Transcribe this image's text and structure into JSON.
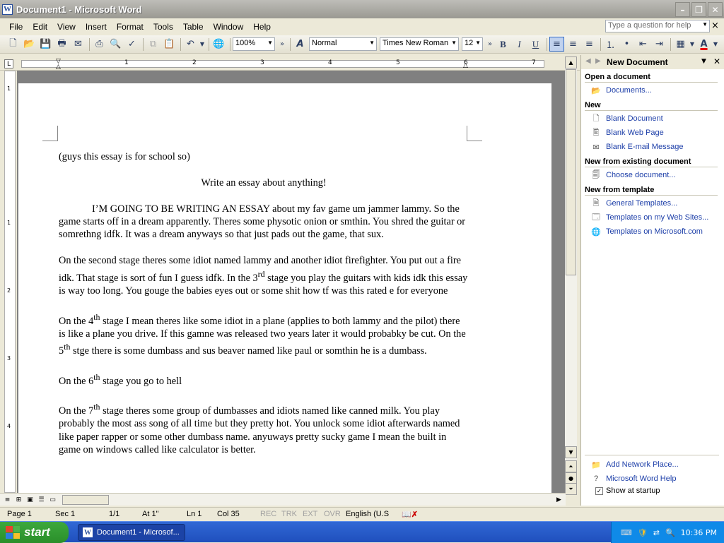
{
  "window": {
    "title": "Document1 - Microsoft Word",
    "app_icon_letter": "W",
    "min_glyph": "–",
    "max_glyph": "❐",
    "close_glyph": "✕"
  },
  "menu": {
    "items": [
      "File",
      "Edit",
      "View",
      "Insert",
      "Format",
      "Tools",
      "Table",
      "Window",
      "Help"
    ],
    "help_placeholder": "Type a question for help",
    "doc_close_glyph": "×"
  },
  "toolbar": {
    "zoom": "100%",
    "style": "Normal",
    "font": "Times New Roman",
    "size": "12",
    "bold": "B",
    "italic": "I",
    "underline": "U",
    "font_color_glyph": "A"
  },
  "ruler": {
    "numbers": [
      "1",
      "2",
      "3",
      "4",
      "5",
      "6",
      "7"
    ],
    "tab_glyph": "L"
  },
  "vruler": {
    "numbers": [
      "1",
      "1",
      "2",
      "3",
      "4"
    ]
  },
  "document": {
    "line1": "(guys this essay is for  school so)",
    "title": "Write an essay about anything!",
    "p1": "I’M GOING TO BE WRITING AN ESSAY about my fav game um jammer lammy. So the game starts off in a dream apparently. Theres some physotic onion or smthin. You shred the guitar or somrethng idfk. It was a dream anyways so that just pads out the game, that sux.",
    "p2a": "On the second stage theres some idiot named lammy and another idiot firefighter.  You put out a fire idk. That stage is sort of fun I guess idfk. In the 3",
    "p2sup": "rd",
    "p2b": " stage you play the guitars with kids idk this essay is way too long.  You gouge the babies eyes out or some shit how tf was this rated e for everyone",
    "p3a": "On the 4",
    "p3sup1": "th",
    "p3b": " stage I mean theres like some idiot in a plane (applies to both lammy and the pilot) there is like a plane you drive. If this gamne was released two years later it would probabky be cut. On the 5",
    "p3sup2": "th",
    "p3c": " stge there is some dumbass and sus beaver named like paul or somthin he is a dumbass.",
    "p4a": "On the 6",
    "p4sup": "th",
    "p4b": " stage you go to hell",
    "p5a": "On the 7",
    "p5sup": "th",
    "p5b": " stage theres some group of dumbasses and idiots named like canned milk.  You play probably the most ass song of all time but they pretty hot. You unlock some idiot afterwards named like paper rapper or some other dumbass name. anyuways pretty sucky game I mean the built in game on windows called like calculator is better."
  },
  "taskpane": {
    "title": "New Document",
    "sec_open": "Open a document",
    "documents": "Documents...",
    "sec_new": "New",
    "blank_doc": "Blank Document",
    "blank_web": "Blank Web Page",
    "blank_email": "Blank E-mail Message",
    "sec_existing": "New from existing document",
    "choose": "Choose document...",
    "sec_template": "New from template",
    "general": "General Templates...",
    "websites": "Templates on my Web Sites...",
    "mscom": "Templates on Microsoft.com",
    "add_network": "Add Network Place...",
    "word_help": "Microsoft Word Help",
    "show_startup": "Show at startup",
    "dropdown_glyph": "▼",
    "close_glyph": "✕"
  },
  "status": {
    "page": "Page  1",
    "sec": "Sec  1",
    "pages": "1/1",
    "at": "At  1\"",
    "ln": "Ln  1",
    "col": "Col  35",
    "rec": "REC",
    "trk": "TRK",
    "ext": "EXT",
    "ovr": "OVR",
    "lang": "English (U.S"
  },
  "taskbar": {
    "start": "start",
    "task": "Document1 - Microsof...",
    "time": "10:36 PM"
  }
}
